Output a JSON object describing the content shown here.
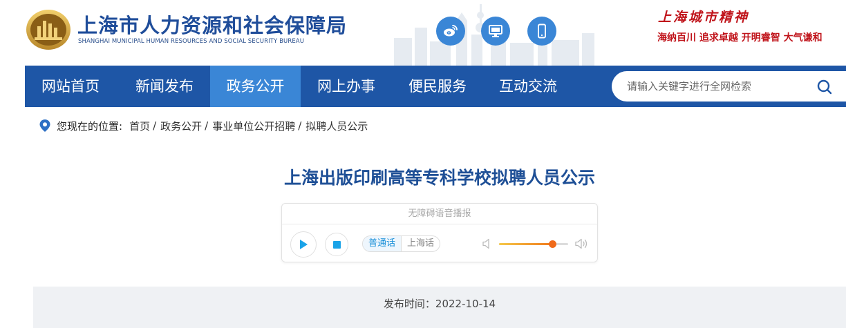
{
  "header": {
    "site_title": "上海市人力资源和社会保障局",
    "site_subtitle": "SHANGHAI MUNICIPAL HUMAN RESOURCES AND SOCIAL SECURITY BUREAU",
    "spirit_title": "上海城市精神",
    "spirit_slogan": "海纳百川  追求卓越  开明睿智  大气谦和",
    "social_icons": [
      "weibo-icon",
      "desktop-icon",
      "mobile-icon"
    ]
  },
  "nav": {
    "items": [
      "网站首页",
      "新闻发布",
      "政务公开",
      "网上办事",
      "便民服务",
      "互动交流"
    ],
    "active_index": 2,
    "search_placeholder": "请输入关键字进行全网检索"
  },
  "breadcrumb": {
    "label": "您现在的位置:",
    "items": [
      "首页",
      "政务公开",
      "事业单位公开招聘",
      "拟聘人员公示"
    ],
    "separator": "/"
  },
  "article": {
    "title": "上海出版印刷高等专科学校拟聘人员公示",
    "publish_time": "发布时间：2022-10-14"
  },
  "player": {
    "header": "无障碍语音播报",
    "languages": [
      "普通话",
      "上海话"
    ],
    "active_language_index": 0,
    "volume_percent": 77
  },
  "colors": {
    "nav_bg": "#1e56a6",
    "nav_active": "#3a86d6",
    "title_blue": "#1e4f96",
    "spirit_red": "#c0141b",
    "accent_cyan": "#1aa3e8"
  }
}
